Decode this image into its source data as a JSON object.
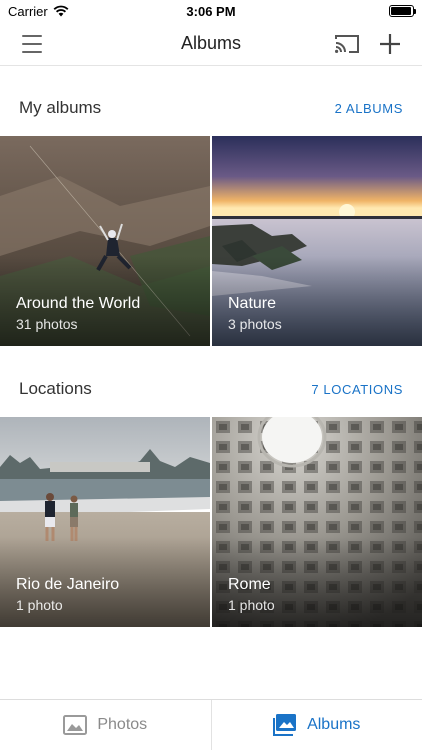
{
  "status_bar": {
    "carrier": "Carrier",
    "time": "3:06 PM",
    "battery_level": 0.95
  },
  "header": {
    "title": "Albums",
    "icons": [
      "menu-icon",
      "cast-icon",
      "add-icon"
    ]
  },
  "my_albums": {
    "title": "My albums",
    "link": "2 ALBUMS",
    "items": [
      {
        "title": "Around the World",
        "subtitle": "31 photos"
      },
      {
        "title": "Nature",
        "subtitle": "3 photos"
      }
    ]
  },
  "locations": {
    "title": "Locations",
    "link": "7 LOCATIONS",
    "items": [
      {
        "title": "Rio de Janeiro",
        "subtitle": "1 photo"
      },
      {
        "title": "Rome",
        "subtitle": "1 photo"
      }
    ]
  },
  "bottom_nav": [
    {
      "label": "Photos",
      "icon": "photo-icon",
      "active": false
    },
    {
      "label": "Albums",
      "icon": "albums-icon",
      "active": true
    }
  ],
  "colors": {
    "accent": "#1a73c7",
    "inactive": "#8a8a8a"
  }
}
